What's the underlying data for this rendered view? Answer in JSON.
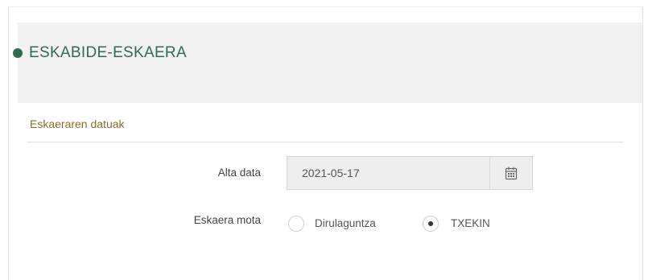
{
  "header": {
    "title": "ESKABIDE-ESKAERA",
    "accent_color": "#2e6b4f"
  },
  "section": {
    "title": "Eskaeraren datuak",
    "title_color": "#8a6d2b"
  },
  "form": {
    "alta_data": {
      "label": "Alta data",
      "value": "2021-05-17",
      "icon": "calendar-icon"
    },
    "eskaera_mota": {
      "label": "Eskaera mota",
      "options": [
        {
          "label": "Dirulaguntza",
          "selected": false
        },
        {
          "label": "TXEKIN",
          "selected": true
        }
      ]
    }
  }
}
